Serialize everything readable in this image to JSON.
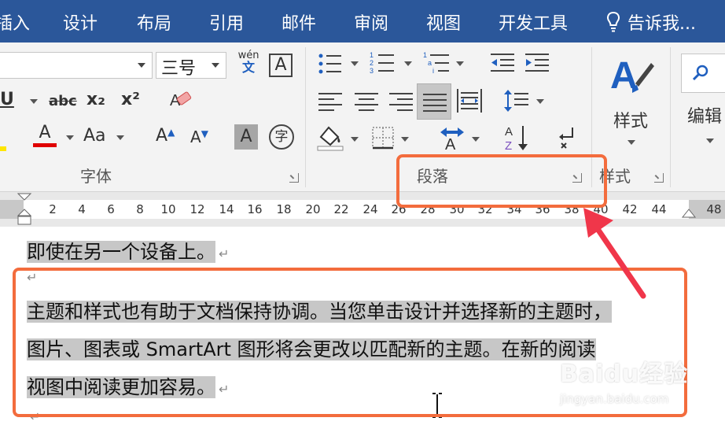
{
  "menu": {
    "tabs": [
      "插入",
      "设计",
      "布局",
      "引用",
      "邮件",
      "审阅",
      "视图",
      "开发工具"
    ],
    "tell_me": "告诉我..."
  },
  "ribbon": {
    "font_name_value": "",
    "font_size_value": "三号",
    "phonetic_top": "wén",
    "phonetic_bottom": "文",
    "char_border": "A",
    "underline": "U",
    "strikethrough": "abc",
    "subscript": "x₂",
    "superscript": "x²",
    "font_color": "A",
    "change_case": "Aa",
    "grow_font": "A",
    "shrink_font": "A",
    "char_shading": "A",
    "enclose_char": "字",
    "sort": "A↓Z",
    "styles_button": "样式",
    "editing_button": "编辑",
    "groups": {
      "font": "字体",
      "paragraph": "段落",
      "styles": "样式"
    }
  },
  "ruler": {
    "ticks": [
      "2",
      "4",
      "6",
      "8",
      "10",
      "12",
      "14",
      "16",
      "18",
      "20",
      "22",
      "24",
      "26",
      "28",
      "30",
      "32",
      "34",
      "36",
      "38",
      "40",
      "42",
      "44",
      "48"
    ]
  },
  "document": {
    "lines": [
      "即使在另一个设备上。",
      "",
      "主题和样式也有助于文档保持协调。当您单击设计并选择新的主题时，",
      "图片、图表或 SmartArt 图形将会更改以匹配新的主题。在新的阅读",
      "视图中阅读更加容易。"
    ]
  },
  "watermark": {
    "brand": "Baidu经验",
    "url": "jingyan.baidu.com"
  },
  "colors": {
    "menu_bg": "#2b579a",
    "annotation": "#f36c3d",
    "highlight": "#c7c7c7",
    "font_color_bar": "#e00000"
  }
}
